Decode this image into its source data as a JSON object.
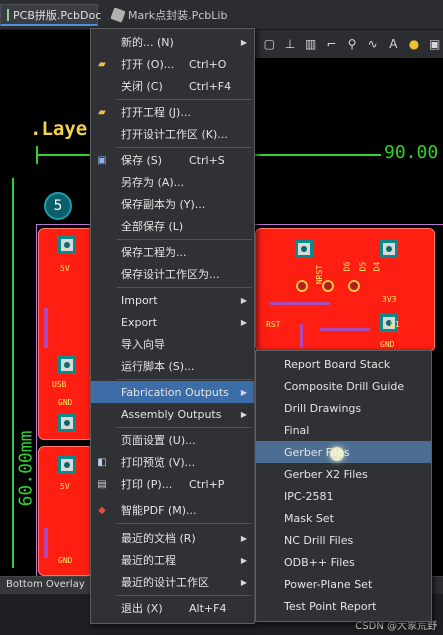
{
  "tabs": [
    {
      "label": "PCB拼版.PcbDoc",
      "icon": "pcb-doc-icon",
      "active": true
    },
    {
      "label": "Mark点封装.PcbLib",
      "icon": "pcb-lib-icon",
      "active": false
    }
  ],
  "canvas": {
    "layer_label": ".Laye",
    "dimension_h": "90.00",
    "dimension_v": "60.00mm",
    "designator_circle": "5",
    "pcb_labels": [
      "5V",
      "USB",
      "GND",
      "5V",
      "GND",
      "D6",
      "D5",
      "D4",
      "NRST",
      "3V3",
      "RST",
      "D1",
      "GND"
    ]
  },
  "layer_bar": {
    "tab": "Bottom Overlay"
  },
  "watermark": "CSDN @大象荒野",
  "menu": {
    "items": [
      {
        "icon": "",
        "label": "新的... (N)",
        "shortcut": "",
        "arrow": true
      },
      {
        "icon": "open-folder-icon",
        "label": "打开 (O)...",
        "shortcut": "Ctrl+O",
        "arrow": false
      },
      {
        "icon": "",
        "label": "关闭 (C)",
        "shortcut": "Ctrl+F4",
        "arrow": false
      },
      {
        "icon": "open-project-icon",
        "label": "打开工程 (J)...",
        "shortcut": "",
        "arrow": false
      },
      {
        "icon": "",
        "label": "打开设计工作区 (K)...",
        "shortcut": "",
        "arrow": false
      },
      {
        "icon": "save-icon",
        "label": "保存 (S)",
        "shortcut": "Ctrl+S",
        "arrow": false
      },
      {
        "icon": "",
        "label": "另存为 (A)...",
        "shortcut": "",
        "arrow": false
      },
      {
        "icon": "",
        "label": "保存副本为 (Y)...",
        "shortcut": "",
        "arrow": false
      },
      {
        "icon": "",
        "label": "全部保存 (L)",
        "shortcut": "",
        "arrow": false
      },
      {
        "icon": "",
        "label": "保存工程为...",
        "shortcut": "",
        "arrow": false
      },
      {
        "icon": "",
        "label": "保存设计工作区为...",
        "shortcut": "",
        "arrow": false
      },
      {
        "icon": "",
        "label": "Import",
        "shortcut": "",
        "arrow": true
      },
      {
        "icon": "",
        "label": "Export",
        "shortcut": "",
        "arrow": true
      },
      {
        "icon": "",
        "label": "导入向导",
        "shortcut": "",
        "arrow": false
      },
      {
        "icon": "",
        "label": "运行脚本 (S)...",
        "shortcut": "",
        "arrow": false
      },
      {
        "icon": "",
        "label": "Fabrication Outputs",
        "shortcut": "",
        "arrow": true
      },
      {
        "icon": "",
        "label": "Assembly Outputs",
        "shortcut": "",
        "arrow": true
      },
      {
        "icon": "",
        "label": "页面设置 (U)...",
        "shortcut": "",
        "arrow": false
      },
      {
        "icon": "print-preview-icon",
        "label": "打印预览 (V)...",
        "shortcut": "",
        "arrow": false
      },
      {
        "icon": "print-icon",
        "label": "打印 (P)...",
        "shortcut": "Ctrl+P",
        "arrow": false
      },
      {
        "icon": "pdf-icon",
        "label": "智能PDF (M)...",
        "shortcut": "",
        "arrow": false
      },
      {
        "icon": "",
        "label": "最近的文档 (R)",
        "shortcut": "",
        "arrow": true
      },
      {
        "icon": "",
        "label": "最近的工程",
        "shortcut": "",
        "arrow": true
      },
      {
        "icon": "",
        "label": "最近的设计工作区",
        "shortcut": "",
        "arrow": true
      },
      {
        "icon": "",
        "label": "退出 (X)",
        "shortcut": "Alt+F4",
        "arrow": false
      }
    ],
    "highlighted": "Fabrication Outputs"
  },
  "submenu": {
    "items": [
      "Report Board Stack",
      "Composite Drill Guide",
      "Drill Drawings",
      "Final",
      "Gerber Files",
      "Gerber X2 Files",
      "IPC-2581",
      "Mask Set",
      "NC Drill Files",
      "ODB++ Files",
      "Power-Plane Set",
      "Test Point Report"
    ],
    "hovered": "Gerber Files"
  }
}
